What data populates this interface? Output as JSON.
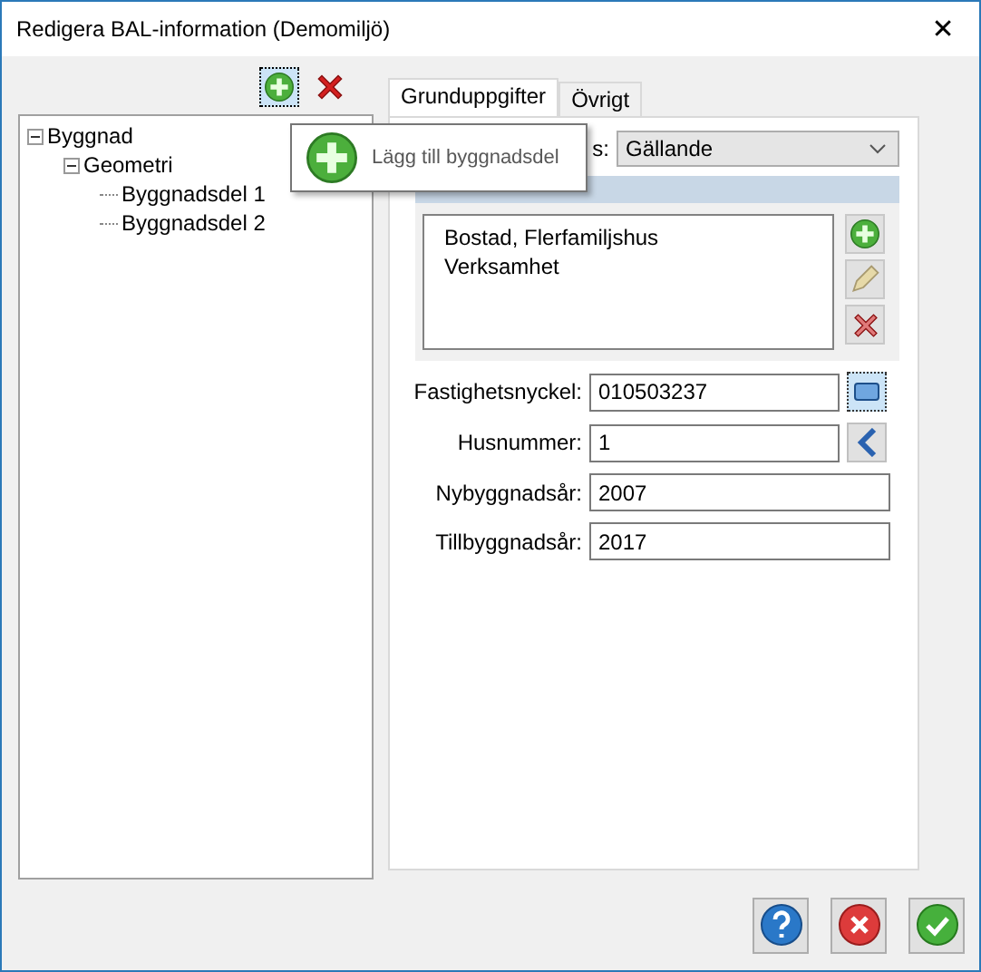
{
  "window": {
    "title": "Redigera BAL-information (Demomiljö)",
    "close": "✕"
  },
  "tree": [
    {
      "label": "Byggnad",
      "expanded": true,
      "children": [
        {
          "label": "Geometri",
          "expanded": true,
          "children": [
            {
              "label": "Byggnadsdel 1"
            },
            {
              "label": "Byggnadsdel 2"
            }
          ]
        }
      ]
    }
  ],
  "tooltip": {
    "text": "Lägg till byggnadsdel"
  },
  "tabs": [
    {
      "label": "Grunduppgifter",
      "selected": true
    },
    {
      "label": "Övrigt",
      "selected": false
    }
  ],
  "status": {
    "label": "s:",
    "value": "Gällande"
  },
  "usage_list": [
    "Bostad, Flerfamiljshus",
    "Verksamhet"
  ],
  "fields": [
    {
      "label": "Fastighetsnyckel:",
      "value": "010503237",
      "kind": "lookup"
    },
    {
      "label": "Husnummer:",
      "value": "1",
      "kind": "back"
    },
    {
      "label": "Nybyggnadsår:",
      "value": "2007",
      "kind": "plain"
    },
    {
      "label": "Tillbyggnadsår:",
      "value": "2017",
      "kind": "plain"
    }
  ]
}
